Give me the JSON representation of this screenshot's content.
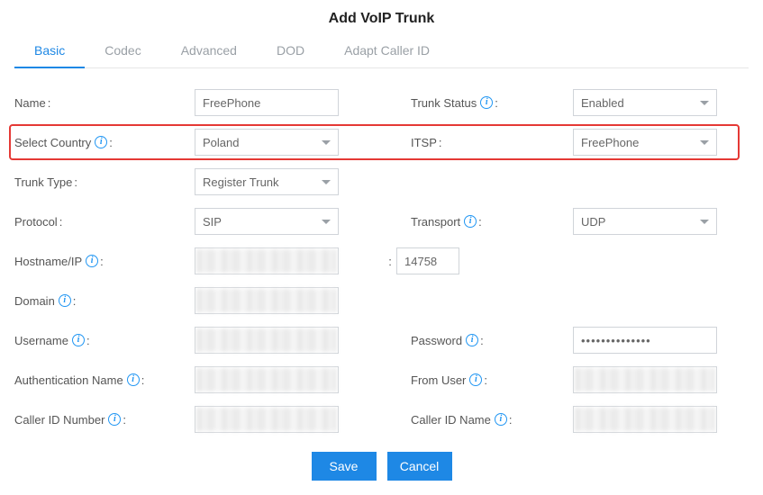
{
  "title": "Add VoIP Trunk",
  "tabs": [
    "Basic",
    "Codec",
    "Advanced",
    "DOD",
    "Adapt Caller ID"
  ],
  "active_tab": 0,
  "labels": {
    "name": "Name",
    "trunk_status": "Trunk Status",
    "select_country": "Select Country",
    "itsp": "ITSP",
    "trunk_type": "Trunk Type",
    "protocol": "Protocol",
    "transport": "Transport",
    "hostname_ip": "Hostname/IP",
    "domain": "Domain",
    "username": "Username",
    "password": "Password",
    "auth_name": "Authentication Name",
    "from_user": "From User",
    "caller_id_number": "Caller ID Number",
    "caller_id_name": "Caller ID Name"
  },
  "values": {
    "name": "FreePhone",
    "trunk_status": "Enabled",
    "select_country": "Poland",
    "itsp": "FreePhone",
    "trunk_type": "Register Trunk",
    "protocol": "SIP",
    "transport": "UDP",
    "port": "14758",
    "password_masked": "••••••••••••••"
  },
  "buttons": {
    "save": "Save",
    "cancel": "Cancel"
  },
  "info_glyph": "i",
  "port_sep": ":"
}
